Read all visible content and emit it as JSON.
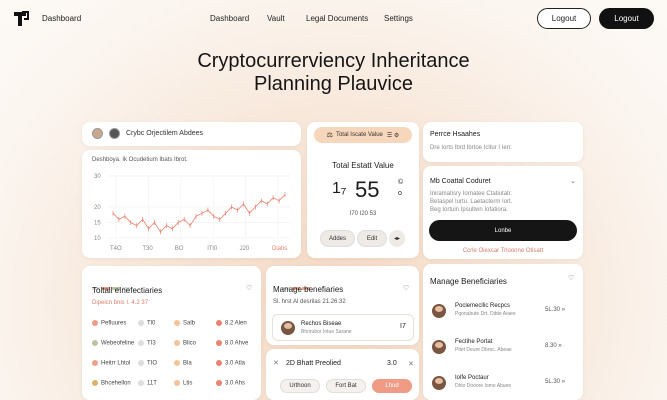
{
  "nav": {
    "brand": "Dashboard",
    "links": [
      "Dashboard",
      "Vault",
      "Legal Documents",
      "Settings"
    ],
    "btn_outline": "Logout",
    "btn_dark": "Logout"
  },
  "hero": {
    "line1": "Cryptocurrerviency Inheritance",
    "line2": "Planning Plauvice"
  },
  "chart_card": {
    "header": "Crybc Orjectilem Abdees",
    "subtitle": "Deshboya. Ik Ocudetium Ibats Ibrot.",
    "accent": "#e9826f"
  },
  "chart_data": {
    "type": "line",
    "title": "",
    "x_ticks": [
      "T4O",
      "T30",
      "BO",
      "ITl0",
      "J20",
      "Diatis"
    ],
    "y_ticks": [
      "30",
      "20",
      "15",
      "10"
    ],
    "ylim": [
      10,
      30
    ],
    "values": [
      18,
      16,
      17,
      15,
      14,
      16,
      13,
      15,
      12,
      14,
      13,
      15,
      16,
      14,
      17,
      18,
      19,
      17,
      16,
      18,
      20,
      19,
      21,
      18,
      20,
      22,
      21,
      23,
      22,
      24
    ]
  },
  "value_card": {
    "tag": "Total Iscate Value",
    "tag_icons": "☰ ⚙",
    "label": "Total Estatt Value",
    "num_left": "1₇",
    "num_main": "55",
    "suffix1": "©",
    "suffix2": "o",
    "sub": "I70 I20 53",
    "btn_add": "Addes",
    "btn_edit": "Edit",
    "btn_icon": "◂▸"
  },
  "right_top": {
    "title": "Perrce Hsaahes",
    "sub": "Dre Iorts Ibrd Ibrtoe Icltur I Ierr."
  },
  "contact_card": {
    "title": "Mb Coattal Coduret",
    "line1": "Iniramatisry Iornatee Ctatiutatr.",
    "line2": "Betaspel Iurtu. Laetacterm Iort.",
    "line3": "Beg Iortuin Ipsultwn Iofatiora.",
    "btn": "Lonbe",
    "link": "Ccrle Oiexcar Trloonne Otisatt"
  },
  "bene_left": {
    "title": "Toltall eInefectiaries",
    "sub": "Dipeicn bnis I. 4.2 37",
    "rows": [
      {
        "a": "Pefluures",
        "b": "Tl0",
        "c": "Salb",
        "d": "8.2 Alen"
      },
      {
        "a": "Webeofeline",
        "b": "TI3",
        "c": "Blico",
        "d": "8.0 Ahve"
      },
      {
        "a": "Heitrr Lhtol",
        "b": "TIO",
        "c": "Bla",
        "d": "3.0 Atla"
      },
      {
        "a": "Bhcehellon",
        "b": "11T",
        "c": "Ltis",
        "d": "3.0 Ahs"
      }
    ]
  },
  "bene_mid": {
    "title": "Manage benefiaries",
    "sub": "Sl. hrst Al desrilas 21.26.32",
    "person_name": "Rechos Biseae",
    "person_sub": "Bhrirubor Iotue Sarane",
    "person_val": "I7",
    "bottom_title": "2D Bhatt Preolied",
    "bottom_val": "3.0",
    "btns": [
      "Urthoon",
      "Fort Bat",
      "Lhud"
    ]
  },
  "bene_right": {
    "title": "Manage Beneficiaries",
    "rows": [
      {
        "name": "Poclemecllic Recpcs",
        "sub": "Pqonabute Drt. Dibte Aiaee",
        "val": "5L.30 »"
      },
      {
        "name": "Fectihe Portat",
        "sub": "Pitet Deure Dbrec. Abeae",
        "val": "8.30 »"
      },
      {
        "name": "Iolfe Poctaur",
        "sub": "Dhio Dooore Iomo Abuee",
        "val": "5L.30 »"
      }
    ]
  }
}
